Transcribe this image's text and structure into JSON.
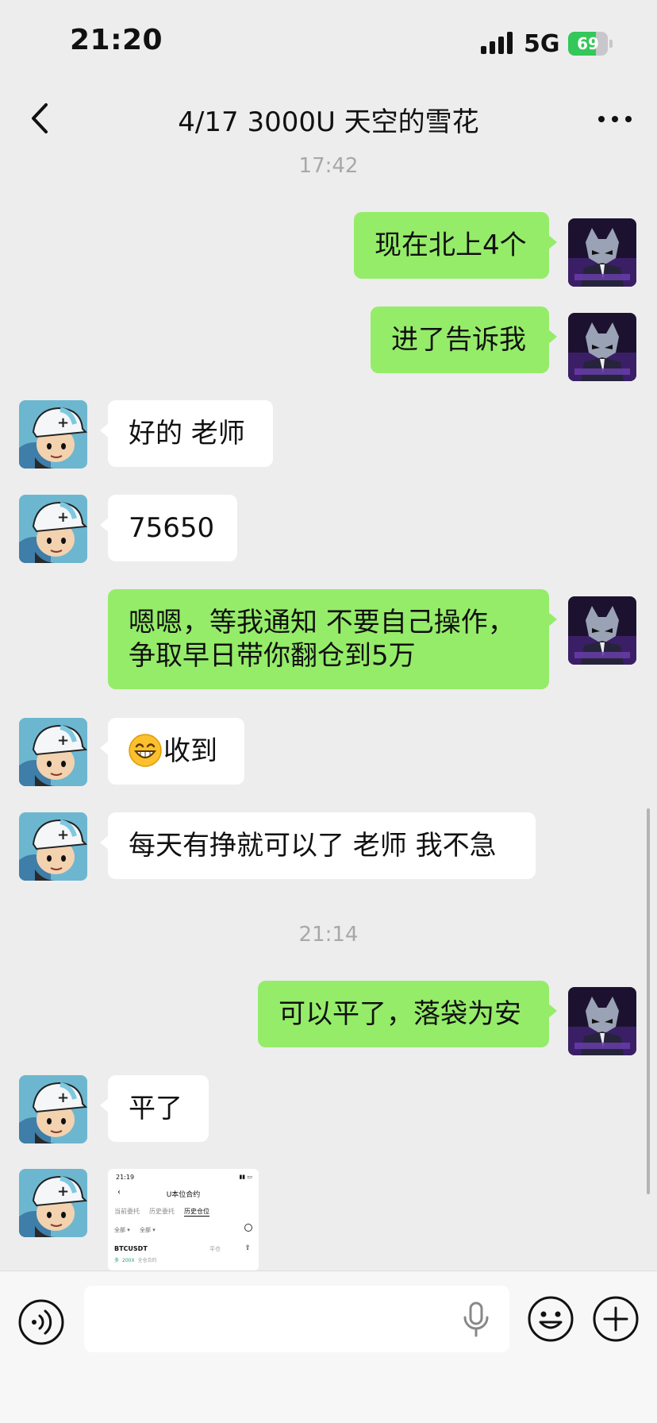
{
  "status_bar": {
    "time": "21:20",
    "network": "5G",
    "battery": "69",
    "battery_level": 0.69,
    "battery_color": "#34c759"
  },
  "nav": {
    "back_icon": "chevron-left-icon",
    "title": "4/17 3000U 天空的雪花",
    "more_icon": "more-horizontal-icon"
  },
  "colors": {
    "background": "#ededed",
    "sent_bubble": "#95ec69",
    "received_bubble": "#ffffff",
    "timestamp": "#a8a8a8"
  },
  "messages": [
    {
      "kind": "time",
      "text": "17:42"
    },
    {
      "kind": "sent",
      "text": "现在北上4个"
    },
    {
      "kind": "sent",
      "text": "进了告诉我"
    },
    {
      "kind": "received",
      "text": "好的 老师"
    },
    {
      "kind": "received",
      "text": "75650"
    },
    {
      "kind": "sent",
      "lines": [
        "嗯嗯，等我通知 不要自己操作，",
        "争取早日带你翻仓到5万"
      ]
    },
    {
      "kind": "received",
      "emoji": "grinning-face-emoji",
      "text": "收到"
    },
    {
      "kind": "received",
      "text": "每天有挣就可以了 老师 我不急"
    },
    {
      "kind": "time",
      "text": "21:14"
    },
    {
      "kind": "sent",
      "text": "可以平了，落袋为安"
    },
    {
      "kind": "received",
      "text": "平了"
    },
    {
      "kind": "received_image",
      "image": "screenshot-thumbnail"
    }
  ],
  "image_message": {
    "time": "21:19",
    "title": "U本位合约",
    "tabs": [
      "当前委托",
      "历史委托",
      "历史仓位"
    ],
    "active_tab": "历史仓位",
    "filters": [
      "全部 ▾",
      "全部 ▾"
    ],
    "symbol": "BTCUSDT",
    "status": "平仓",
    "tags": [
      "多",
      "200X",
      "全仓合约"
    ]
  },
  "input_bar": {
    "voice_icon": "voice-mode-icon",
    "mic_icon": "microphone-icon",
    "emoji_icon": "emoji-icon",
    "plus_icon": "plus-icon"
  }
}
